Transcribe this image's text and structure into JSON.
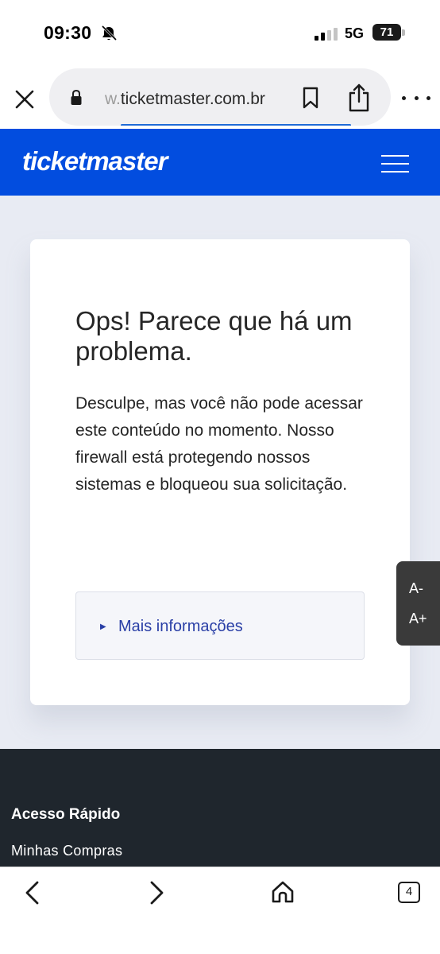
{
  "status_bar": {
    "time": "09:30",
    "network": "5G",
    "battery": "71"
  },
  "browser": {
    "url_prefix": "w.",
    "url_main": "ticketmaster.com.br"
  },
  "header": {
    "logo": "ticketmaster",
    "accent_color": "#024ddf"
  },
  "card": {
    "title": "Ops! Parece que há um problema.",
    "message": "Desculpe, mas você não pode acessar este conteúdo no momento. Nosso firewall está protegendo nossos sistemas e bloqueou sua solicitação.",
    "more_info_arrow": "▶",
    "more_info_label": "Mais informações"
  },
  "accessibility": {
    "decrease": "A-",
    "increase": "A+"
  },
  "footer": {
    "heading": "Acesso Rápido",
    "link": "Minhas Compras"
  },
  "toolbar": {
    "tab_count": "4"
  }
}
